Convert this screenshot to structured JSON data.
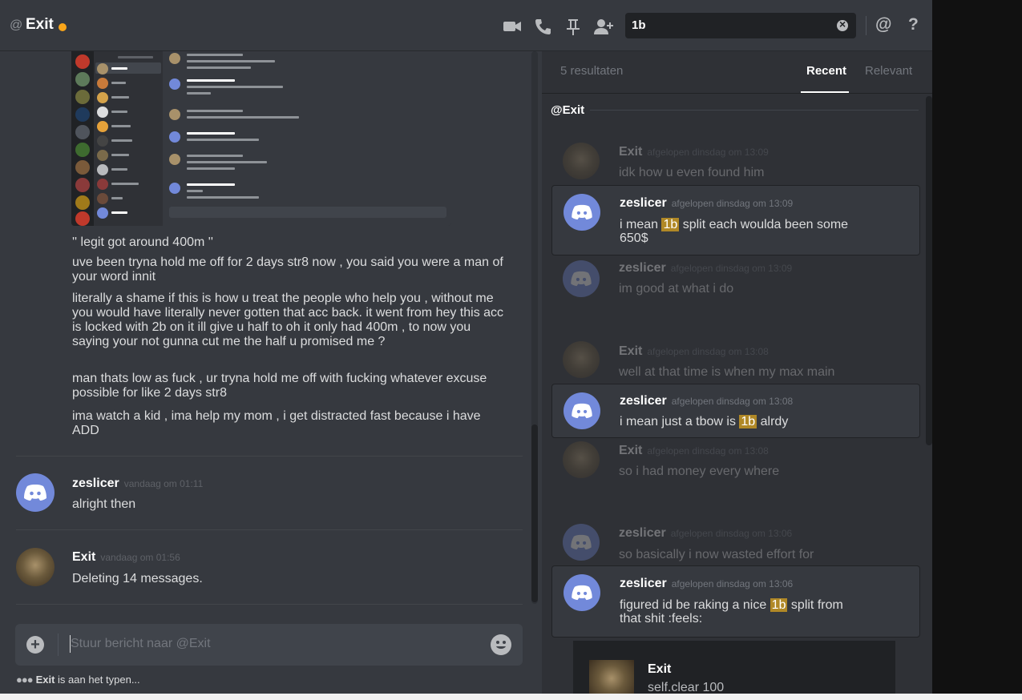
{
  "header": {
    "at_symbol": "@",
    "title": "Exit",
    "search_value": "1b",
    "mention_label": "@",
    "help_label": "?"
  },
  "chat": {
    "messages_continued": [
      "'' legit got around 400m ''",
      "uve been tryna hold me off for 2 days str8 now , you said you were a man of your word innit",
      "literally a shame if this is how u treat the people who help you , without me you would have literally never gotten that acc back. it went from hey this acc is locked with 2b on it ill give u half to oh it only had 400m , to now you saying your not gunna cut me the half u promised me ?",
      "man thats low as fuck , ur tryna hold me off with fucking whatever excuse possible for like 2 days str8",
      "ima watch a kid , ima help my mom , i get distracted fast because i have ADD"
    ],
    "messages": [
      {
        "author": "zeslicer",
        "time": "vandaag om 01:11",
        "text": "alright then"
      },
      {
        "author": "Exit",
        "time": "vandaag om 01:56",
        "text": "Deleting 14 messages."
      }
    ],
    "composer_placeholder": "Stuur bericht naar @Exit",
    "typing_user": "Exit",
    "typing_text": "is aan het typen..."
  },
  "results": {
    "count": "5 resultaten",
    "tab_recent": "Recent",
    "tab_relevant": "Relevant",
    "channel": "@Exit",
    "items": [
      {
        "author": "Exit",
        "time": "afgelopen dinsdag om 13:09",
        "text": "idk how u even found him"
      },
      {
        "author": "zeslicer",
        "time": "afgelopen dinsdag om 13:09",
        "pre": "i mean ",
        "match": "1b",
        "post": " split each woulda been some 650$"
      },
      {
        "author": "zeslicer",
        "time": "afgelopen dinsdag om 13:09",
        "text": "im good at what i do"
      },
      {
        "author": "Exit",
        "time": "afgelopen dinsdag om 13:08",
        "text": "well at that time is when my max main"
      },
      {
        "author": "zeslicer",
        "time": "afgelopen dinsdag om 13:08",
        "pre": "i mean just a tbow is ",
        "match": "1b",
        "post": " alrdy"
      },
      {
        "author": "Exit",
        "time": "afgelopen dinsdag om 13:08",
        "text": "so i had money every where"
      },
      {
        "author": "zeslicer",
        "time": "afgelopen dinsdag om 13:06",
        "text": "so basically i now wasted effort for"
      },
      {
        "author": "zeslicer",
        "time": "afgelopen dinsdag om 13:06",
        "pre": "figured id be raking a nice ",
        "match": "1b",
        "post": " split from that shit :feels:"
      }
    ],
    "popup": {
      "author": "Exit",
      "text": "self.clear 100"
    }
  },
  "colors": {
    "background": "#36393f",
    "panel": "#2f3136",
    "discord_blurple": "#7289da",
    "status_idle": "#faa61a",
    "highlight": "#b08826"
  }
}
